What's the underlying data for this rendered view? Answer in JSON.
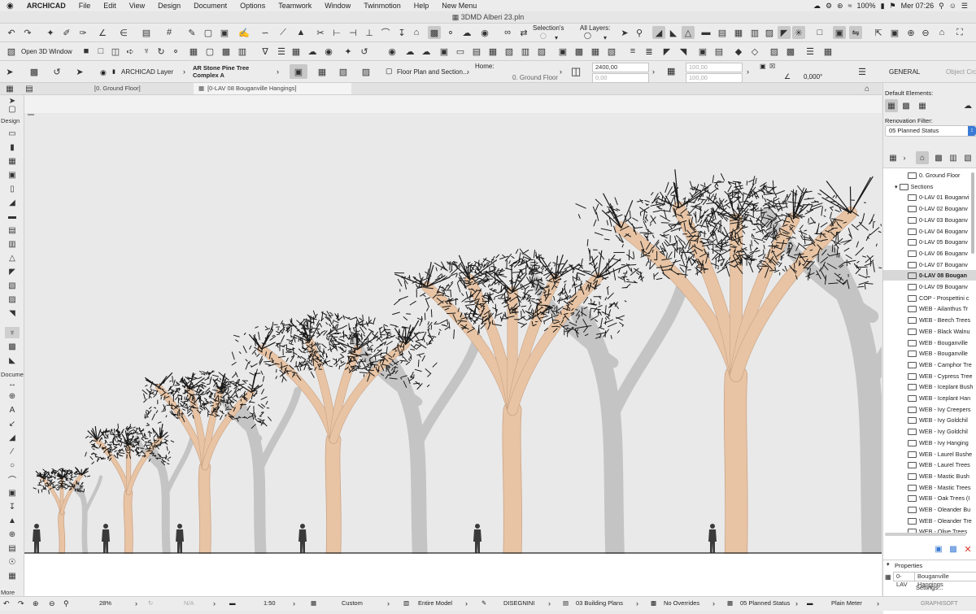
{
  "menubar": {
    "apple": "",
    "app": "ARCHICAD",
    "items": [
      "File",
      "Edit",
      "View",
      "Design",
      "Document",
      "Options",
      "Teamwork",
      "Window",
      "Twinmotion",
      "Help",
      "New Menu"
    ],
    "battery": "100%",
    "clock": "Mer 07:26"
  },
  "window_title": "3DMD Alberi 23.pln",
  "toolbar1": {
    "selection_label": "Selection's",
    "layers_label": "All Layers:"
  },
  "toolbar2": {
    "open3d_label": "Open 3D Window"
  },
  "infobox": {
    "layer_label": "ARCHICAD Layer",
    "object_name_line1": "AR Stone Pine Tree",
    "object_name_line2": "Complex A",
    "floorplan_section": "Floor Plan and Section...",
    "home_label": "Home:",
    "home_value": "0. Ground Floor",
    "height_value": "2400,00",
    "offset_value": "0,00",
    "field_a": "100,00",
    "field_b": "100,00",
    "angle_value": "0,000°",
    "general_label": "GENERAL",
    "object_crop": "Object Crop"
  },
  "tabs": [
    {
      "label": "[0. Ground Floor]"
    },
    {
      "label": "[0-LAV 08 Bouganville Hangings]"
    }
  ],
  "left_palette": {
    "design_label": "Design",
    "document_label": "Docume",
    "more_label": "More"
  },
  "right_palette": {
    "default_elements": "Default Elements:",
    "renovation_filter": "Renovation Filter:",
    "renovation_value": "05 Planned Status",
    "properties_label": "Properties",
    "prop_id": "0-LAV",
    "prop_name": "Bouganville Hangings",
    "settings_label": "Settings..."
  },
  "navigator": [
    {
      "label": "0. Ground Floor",
      "indent": 2,
      "type": "floor"
    },
    {
      "label": "Sections",
      "indent": 1,
      "type": "folder"
    },
    {
      "label": "0-LAV 01 Bouganvi",
      "indent": 2,
      "type": "view"
    },
    {
      "label": "0-LAV 02 Bouganv",
      "indent": 2,
      "type": "view"
    },
    {
      "label": "0-LAV 03 Bouganv",
      "indent": 2,
      "type": "view"
    },
    {
      "label": "0-LAV 04 Bouganv",
      "indent": 2,
      "type": "view"
    },
    {
      "label": "0-LAV 05 Bouganv",
      "indent": 2,
      "type": "view"
    },
    {
      "label": "0-LAV 06 Bouganv",
      "indent": 2,
      "type": "view"
    },
    {
      "label": "0-LAV 07 Bouganv",
      "indent": 2,
      "type": "view"
    },
    {
      "label": "0-LAV 08 Bougan",
      "indent": 2,
      "type": "view",
      "selected": true
    },
    {
      "label": "0-LAV 09 Bouganv",
      "indent": 2,
      "type": "view"
    },
    {
      "label": "COP - Prospettini c",
      "indent": 2,
      "type": "view"
    },
    {
      "label": "WEB - Ailanthus Tr",
      "indent": 2,
      "type": "view"
    },
    {
      "label": "WEB - Beech Trees",
      "indent": 2,
      "type": "view"
    },
    {
      "label": "WEB - Black Walnu",
      "indent": 2,
      "type": "view"
    },
    {
      "label": "WEB - Bouganville",
      "indent": 2,
      "type": "view"
    },
    {
      "label": "WEB - Bouganville",
      "indent": 2,
      "type": "view"
    },
    {
      "label": "WEB - Camphor Tre",
      "indent": 2,
      "type": "view"
    },
    {
      "label": "WEB - Cypress Tree",
      "indent": 2,
      "type": "view"
    },
    {
      "label": "WEB - Iceplant Bush",
      "indent": 2,
      "type": "view"
    },
    {
      "label": "WEB - Iceplant Han",
      "indent": 2,
      "type": "view"
    },
    {
      "label": "WEB - Ivy Creepers",
      "indent": 2,
      "type": "view"
    },
    {
      "label": "WEB - Ivy Goldchil",
      "indent": 2,
      "type": "view"
    },
    {
      "label": "WEB - Ivy Goldchil",
      "indent": 2,
      "type": "view"
    },
    {
      "label": "WEB - Ivy Hanging",
      "indent": 2,
      "type": "view"
    },
    {
      "label": "WEB - Laurel Bushe",
      "indent": 2,
      "type": "view"
    },
    {
      "label": "WEB - Laurel Trees",
      "indent": 2,
      "type": "view"
    },
    {
      "label": "WEB - Mastic Bush",
      "indent": 2,
      "type": "view"
    },
    {
      "label": "WEB - Mastic Trees",
      "indent": 2,
      "type": "view"
    },
    {
      "label": "WEB - Oak Trees (I",
      "indent": 2,
      "type": "view"
    },
    {
      "label": "WEB - Oleander Bu",
      "indent": 2,
      "type": "view"
    },
    {
      "label": "WEB - Oleander Tre",
      "indent": 2,
      "type": "view"
    },
    {
      "label": "WEB - Olive Trees",
      "indent": 2,
      "type": "view"
    }
  ],
  "statusbar": {
    "zoom": "28%",
    "na": "N/A",
    "scale": "1:50",
    "custom": "Custom",
    "entire_model": "Entire Model",
    "disegnini": "DISEGNINI",
    "building_plans": "03 Building Plans",
    "no_overrides": "No Overrides",
    "planned_status": "05 Planned Status",
    "plain_meter": "Plain Meter",
    "graphisoft": "GRAPHISOFT"
  },
  "colors": {
    "trunk": "#e8c4a4",
    "trunk_dark": "#c9a184",
    "shadow": "#c4c4c4",
    "foliage": "#1a1a1a"
  }
}
